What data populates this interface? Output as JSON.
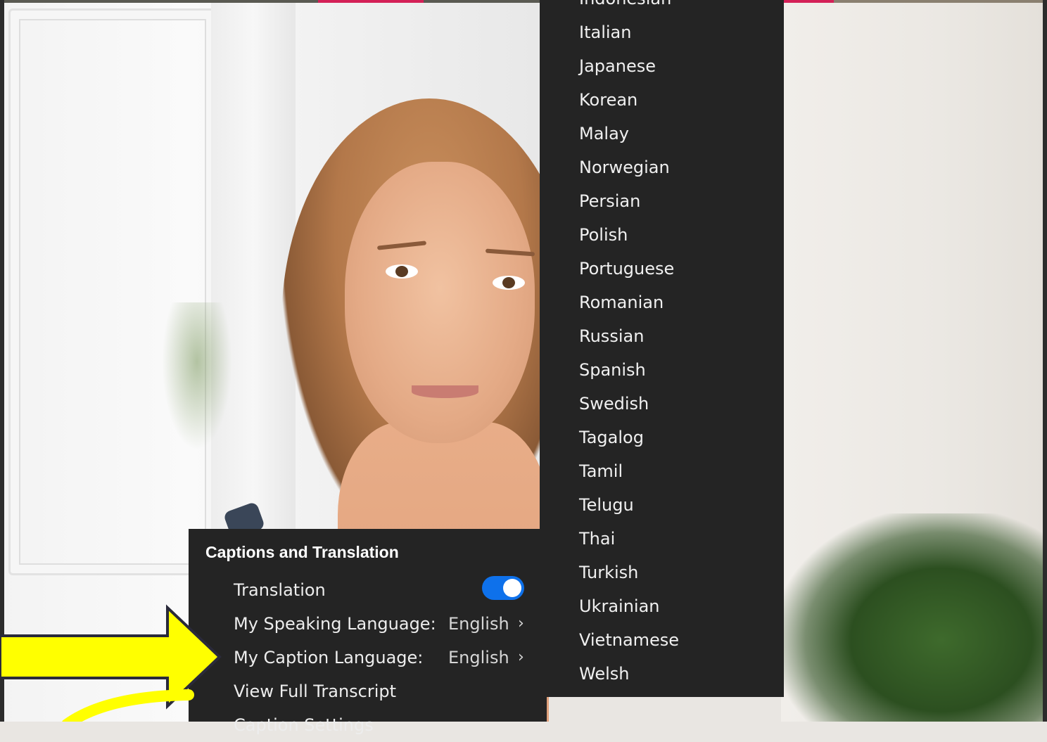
{
  "language_menu": {
    "items": [
      "Indonesian",
      "Italian",
      "Japanese",
      "Korean",
      "Malay",
      "Norwegian",
      "Persian",
      "Polish",
      "Portuguese",
      "Romanian",
      "Russian",
      "Spanish",
      "Swedish",
      "Tagalog",
      "Tamil",
      "Telugu",
      "Thai",
      "Turkish",
      "Ukrainian",
      "Vietnamese",
      "Welsh"
    ]
  },
  "captions_menu": {
    "title": "Captions and Translation",
    "translation_label": "Translation",
    "translation_enabled": true,
    "speaking_language_label": "My Speaking Language:",
    "speaking_language_value": "English",
    "caption_language_label": "My Caption Language:",
    "caption_language_value": "English",
    "view_transcript_label": "View Full Transcript",
    "caption_settings_label": "Caption Settings",
    "chevron": "›"
  },
  "colors": {
    "menu_bg": "#242424",
    "toggle_on": "#0e71eb",
    "annotation_arrow": "#ffff00"
  },
  "icons": {
    "chevron": "chevron-right-icon",
    "toggle": "toggle-switch-icon"
  }
}
